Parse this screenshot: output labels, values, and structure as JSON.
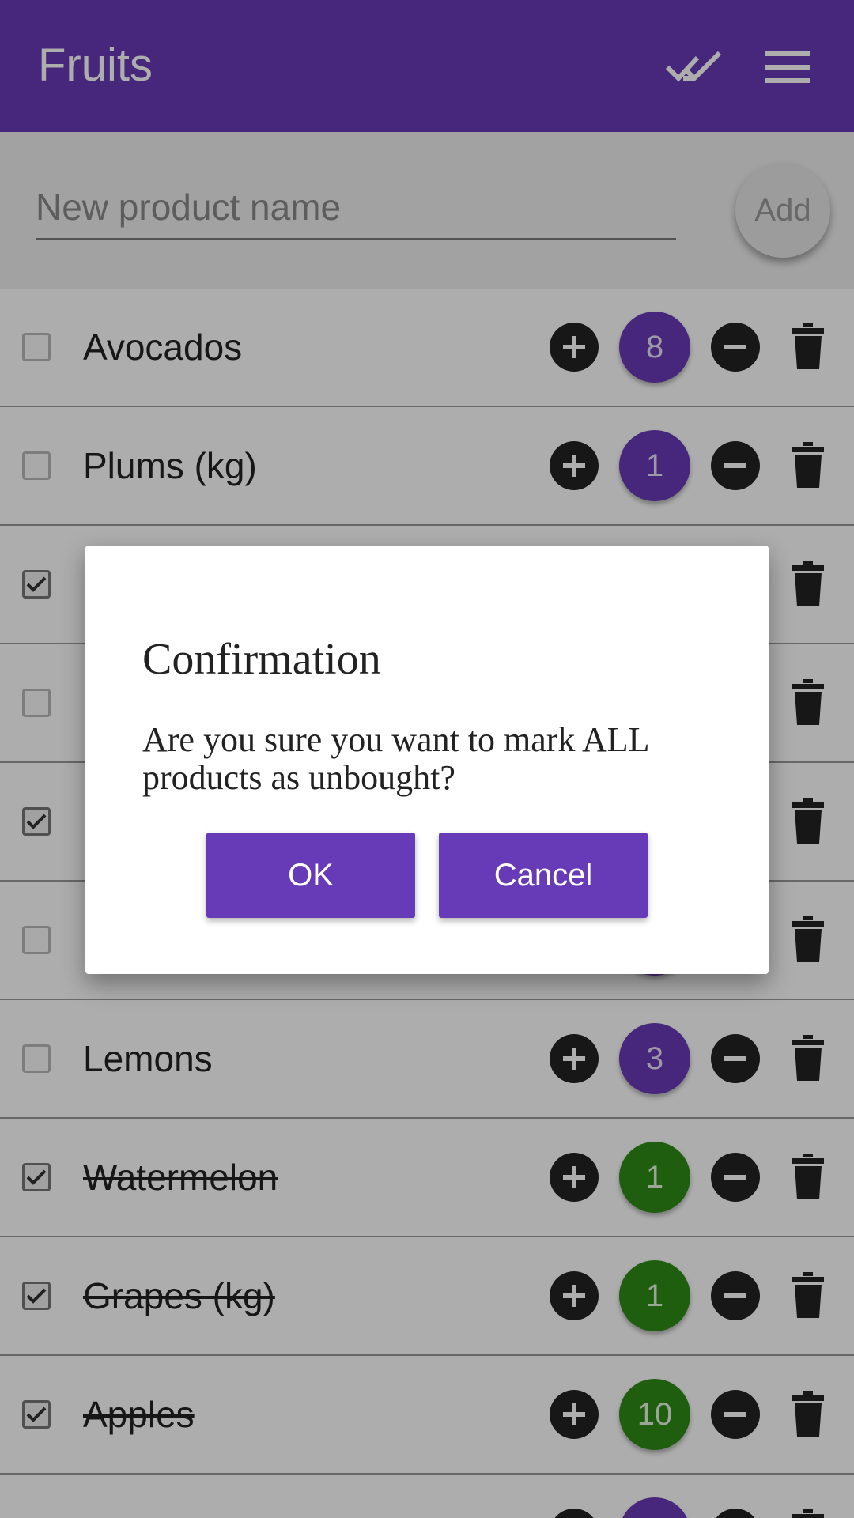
{
  "appbar": {
    "title": "Fruits",
    "actions": [
      {
        "icon": "double-check-icon"
      },
      {
        "icon": "hamburger-menu-icon"
      }
    ],
    "color": "#673ab7"
  },
  "new_product": {
    "placeholder": "New product name",
    "value": "",
    "add_label": "Add"
  },
  "products": [
    {
      "name": "Avocados",
      "qty": "8",
      "checked": false
    },
    {
      "name": "Plums (kg)",
      "qty": "1",
      "checked": false
    },
    {
      "name": "",
      "qty": "",
      "checked": true
    },
    {
      "name": "",
      "qty": "",
      "checked": false
    },
    {
      "name": "",
      "qty": "",
      "checked": true
    },
    {
      "name": "",
      "qty": "",
      "checked": false
    },
    {
      "name": "Lemons",
      "qty": "3",
      "checked": false
    },
    {
      "name": "Watermelon",
      "qty": "1",
      "checked": true
    },
    {
      "name": "Grapes (kg)",
      "qty": "1",
      "checked": true
    },
    {
      "name": "Apples",
      "qty": "10",
      "checked": true
    },
    {
      "name": "",
      "qty": "",
      "checked": false
    }
  ],
  "colors": {
    "accent": "#673ab7",
    "bought": "#2e8b17"
  },
  "dialog": {
    "title": "Confirmation",
    "message": "Are you sure you want to mark ALL products as unbought?",
    "ok_label": "OK",
    "cancel_label": "Cancel"
  }
}
